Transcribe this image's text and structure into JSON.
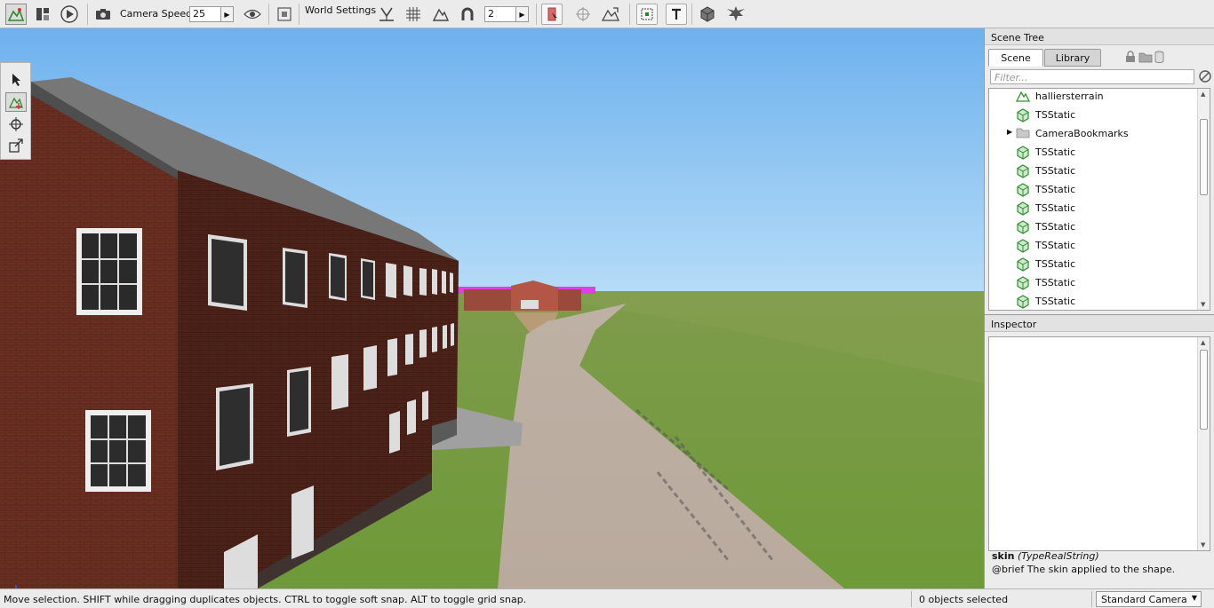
{
  "toolbar": {
    "camera_speed_label": "Camera Speed",
    "camera_speed_value": "25",
    "world_settings_label": "World Settings",
    "snap_value": "2"
  },
  "scene_tree": {
    "title": "Scene Tree",
    "tabs": [
      "Scene",
      "Library"
    ],
    "active_tab": "Scene",
    "filter_placeholder": "Filter...",
    "items": [
      {
        "label": "halliersterrain",
        "icon": "terrain-icon",
        "expandable": false
      },
      {
        "label": "TSStatic",
        "icon": "static-shape-icon",
        "expandable": false
      },
      {
        "label": "CameraBookmarks",
        "icon": "folder-icon",
        "expandable": true
      },
      {
        "label": "TSStatic",
        "icon": "static-shape-icon",
        "expandable": false
      },
      {
        "label": "TSStatic",
        "icon": "static-shape-icon",
        "expandable": false
      },
      {
        "label": "TSStatic",
        "icon": "static-shape-icon",
        "expandable": false
      },
      {
        "label": "TSStatic",
        "icon": "static-shape-icon",
        "expandable": false
      },
      {
        "label": "TSStatic",
        "icon": "static-shape-icon",
        "expandable": false
      },
      {
        "label": "TSStatic",
        "icon": "static-shape-icon",
        "expandable": false
      },
      {
        "label": "TSStatic",
        "icon": "static-shape-icon",
        "expandable": false
      },
      {
        "label": "TSStatic",
        "icon": "static-shape-icon",
        "expandable": false
      },
      {
        "label": "TSStatic",
        "icon": "static-shape-icon",
        "expandable": false
      }
    ]
  },
  "inspector": {
    "title": "Inspector",
    "field_name": "skin",
    "field_type": "(TypeRealString)",
    "field_desc": "@brief The skin applied to the shape."
  },
  "status": {
    "hint": "Move selection.  SHIFT while dragging duplicates objects.  CTRL to toggle soft snap.  ALT to toggle grid snap.",
    "selection": "0 objects selected",
    "camera": "Standard Camera"
  },
  "colors": {
    "sky_top": "#6fb2ee",
    "sky_bottom": "#b3daf7",
    "grass": "#7f9d47",
    "brick": "#5e2a1f",
    "accent_green": "#2f8f2f"
  }
}
